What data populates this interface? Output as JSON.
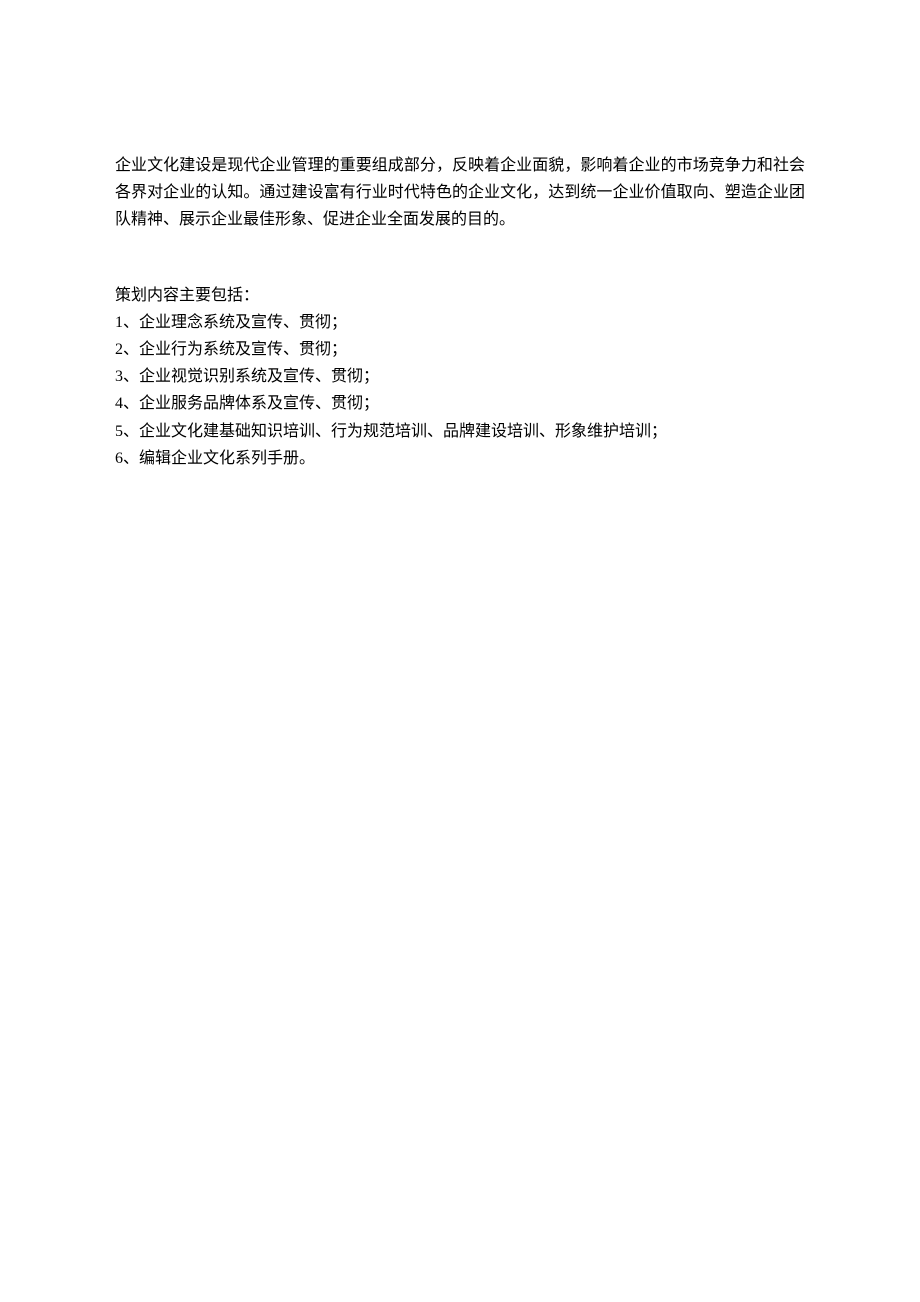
{
  "intro": "企业文化建设是现代企业管理的重要组成部分，反映着企业面貌，影响着企业的市场竞争力和社会各界对企业的认知。通过建设富有行业时代特色的企业文化，达到统一企业价值取向、塑造企业团队精神、展示企业最佳形象、促进企业全面发展的目的。",
  "list_heading": "策划内容主要包括：",
  "items": [
    "1、企业理念系统及宣传、贯彻；",
    "2、企业行为系统及宣传、贯彻；",
    "3、企业视觉识别系统及宣传、贯彻；",
    "4、企业服务品牌体系及宣传、贯彻；",
    "5、企业文化建基础知识培训、行为规范培训、品牌建设培训、形象维护培训；",
    "6、编辑企业文化系列手册。"
  ]
}
